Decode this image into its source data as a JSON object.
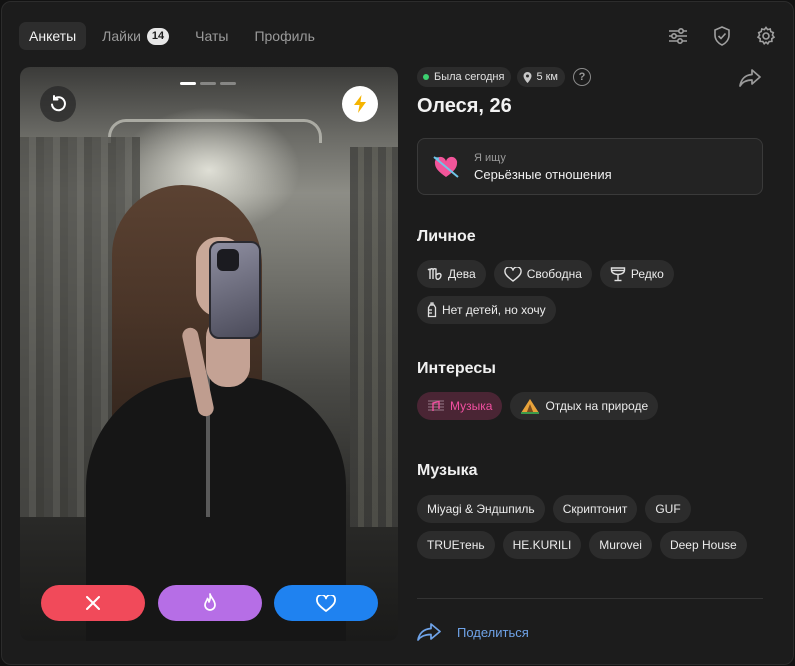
{
  "nav": {
    "tabs": [
      {
        "label": "Анкеты",
        "active": true
      },
      {
        "label": "Лайки",
        "badge": "14"
      },
      {
        "label": "Чаты"
      },
      {
        "label": "Профиль"
      }
    ],
    "icons": [
      "filters-icon",
      "shield-icon",
      "gear-icon"
    ]
  },
  "photo": {
    "pages": 3,
    "current_page": 1,
    "undo_icon": "undo-icon",
    "boost_icon": "lightning-icon",
    "actions": [
      "close-icon",
      "fire-icon",
      "heart-icon"
    ]
  },
  "profile": {
    "status": "Была сегодня",
    "distance": "5 км",
    "name": "Олеся, 26",
    "seeking_label": "Я ищу",
    "seeking_value": "Серьёзные отношения",
    "seeking_icon": "heart-arrow-icon"
  },
  "sections": {
    "personal_title": "Личное",
    "personal": [
      {
        "icon": "virgo-icon",
        "label": "Дева"
      },
      {
        "icon": "heart-icon",
        "label": "Свободна"
      },
      {
        "icon": "glass-icon",
        "label": "Редко"
      },
      {
        "icon": "bottle-icon",
        "label": "Нет детей, но хочу"
      }
    ],
    "interests_title": "Интересы",
    "interests": [
      {
        "icon": "music-icon",
        "label": "Музыка"
      },
      {
        "icon": "camping-icon",
        "label": "Отдых на природе"
      }
    ],
    "music_title": "Музыка",
    "music": [
      "Miyagi & Эндшпиль",
      "Скриптонит",
      "GUF",
      "TRUEтень",
      "HE.KURILI",
      "Murovei",
      "Deep House"
    ]
  },
  "share": {
    "label": "Поделиться"
  },
  "colors": {
    "accent_blue": "#1f82f0",
    "dislike_red": "#f14a5a",
    "fire_purple": "#b66ee6",
    "interest_pink": "#f24fa0",
    "online_green": "#3cd070"
  }
}
